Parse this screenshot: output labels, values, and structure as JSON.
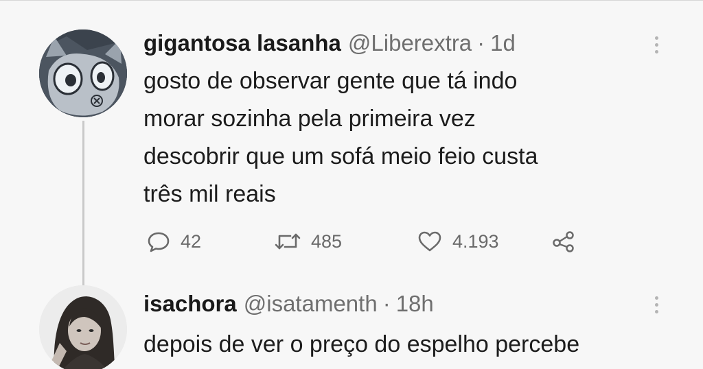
{
  "tweets": [
    {
      "display_name": "gigantosa lasanha",
      "handle": "@Liberextra",
      "separator": "·",
      "time": "1d",
      "avatar_icon": "cartoon-cat-avatar",
      "text": "gosto de observar gente que tá indo\nmorar sozinha pela primeira vez\ndescobrir que um sofá meio feio custa\ntrês mil reais",
      "actions": {
        "replies": "42",
        "retweets": "485",
        "likes": "4.193"
      }
    },
    {
      "display_name": "isachora",
      "handle": "@isatamenth",
      "separator": "·",
      "time": "18h",
      "avatar_icon": "person-photo-avatar",
      "text": "depois de ver o preço do espelho percebe"
    }
  ],
  "icons": {
    "reply": "reply-icon",
    "retweet": "retweet-icon",
    "like": "like-icon",
    "share": "share-icon",
    "more": "more-options-icon"
  },
  "colors": {
    "background": "#f7f7f7",
    "text": "#1c1c1c",
    "secondary_text": "#6f6f6f",
    "thread_line": "#c9c9c9"
  }
}
